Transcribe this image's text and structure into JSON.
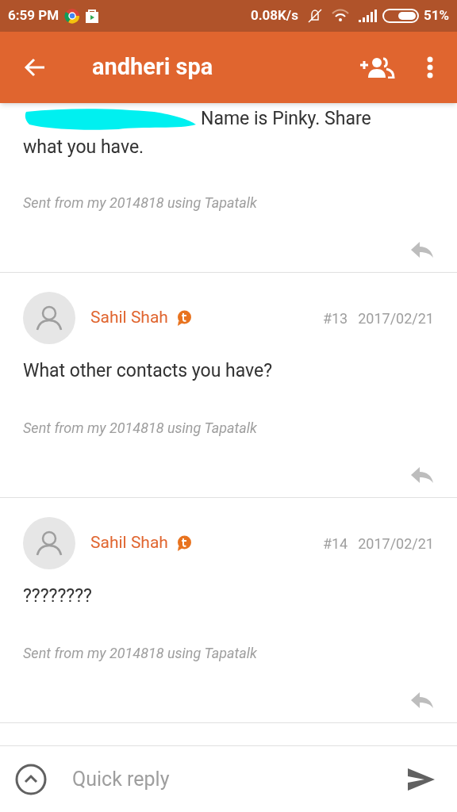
{
  "status_bar": {
    "time": "6:59 PM",
    "speed": "0.08K/s",
    "battery": "51%"
  },
  "app_bar": {
    "title": "andheri spa"
  },
  "posts": [
    {
      "kind": "continued",
      "body_lines": [
        "Name is Pinky. Share",
        "what you have."
      ],
      "signature": "Sent from my 2014818 using Tapatalk"
    },
    {
      "kind": "full",
      "author": "Sahil Shah",
      "number": "#13",
      "date": "2017/02/21",
      "body_lines": [
        "What other contacts you have?"
      ],
      "signature": "Sent from my 2014818 using Tapatalk"
    },
    {
      "kind": "full",
      "author": "Sahil Shah",
      "number": "#14",
      "date": "2017/02/21",
      "body_lines": [
        "????????"
      ],
      "signature": "Sent from my 2014818 using Tapatalk"
    }
  ],
  "quick_reply": {
    "placeholder": "Quick reply"
  }
}
